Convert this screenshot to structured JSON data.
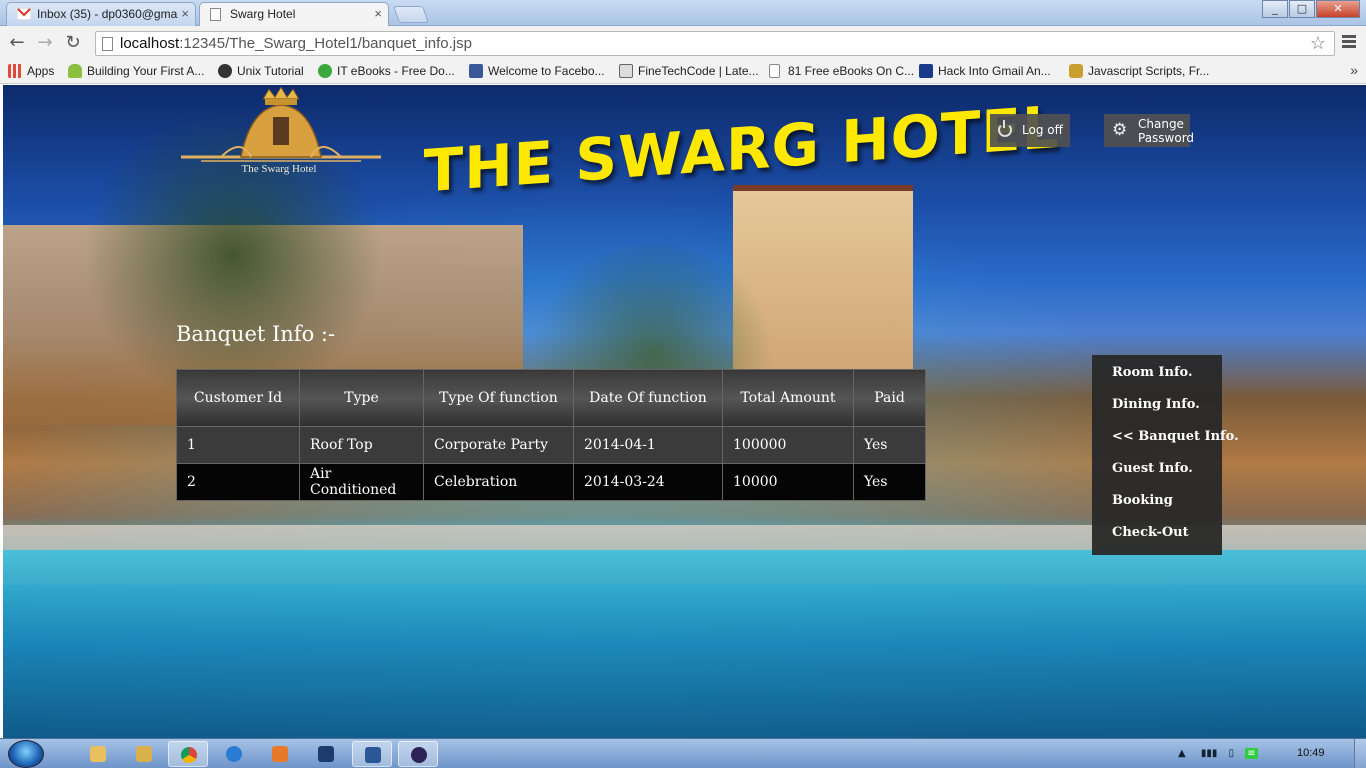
{
  "browser": {
    "tabs": [
      {
        "title": "Inbox (35) - dp0360@gma",
        "close": "×",
        "icon": "gmail-icon"
      },
      {
        "title": "Swarg Hotel",
        "close": "×",
        "icon": "page-icon"
      }
    ],
    "address": {
      "host": "localhost",
      "path": ":12345/The_Swarg_Hotel1/banquet_info.jsp"
    },
    "bookmarks": [
      {
        "label": "Apps",
        "icon": "apps-grid-icon",
        "color": "#e24a3b"
      },
      {
        "label": "Building Your First A...",
        "icon": "android-icon",
        "color": "#8cbf3f"
      },
      {
        "label": "Unix Tutorial",
        "icon": "unix-icon",
        "color": "#333333"
      },
      {
        "label": "IT eBooks - Free Do...",
        "icon": "green-dot-icon",
        "color": "#3aa83a"
      },
      {
        "label": "Welcome to Facebo...",
        "icon": "facebook-icon",
        "color": "#3b5998"
      },
      {
        "label": "FineTechCode | Late...",
        "icon": "ftc-icon",
        "color": "#666666"
      },
      {
        "label": "81 Free eBooks On C...",
        "icon": "page-icon",
        "color": "#ffffff"
      },
      {
        "label": "Hack Into Gmail An...",
        "icon": "efy-icon",
        "color": "#1a3b8a"
      },
      {
        "label": "Javascript Scripts, Fr...",
        "icon": "js-icon",
        "color": "#c9a030"
      }
    ],
    "bookmarks_more": "»"
  },
  "page": {
    "logo_text": "The Swarg Hotel",
    "site_title": "THE SWARG HOTEL",
    "logoff_label": "Log off",
    "change_password_line1": "Change",
    "change_password_line2": "Password",
    "section_title": "Banquet Info :-",
    "table": {
      "headers": [
        "Customer Id",
        "Type",
        "Type Of function",
        "Date Of function",
        "Total Amount",
        "Paid"
      ],
      "rows": [
        [
          "1",
          "Roof Top",
          "Corporate Party",
          "2014-04-1",
          "100000",
          "Yes"
        ],
        [
          "2",
          "Air Conditioned",
          "Celebration",
          "2014-03-24",
          "10000",
          "Yes"
        ]
      ]
    },
    "menu": [
      "Room Info.",
      "Dining Info.",
      "<< Banquet Info.",
      "Guest Info.",
      "Booking",
      "Check-Out"
    ]
  },
  "taskbar": {
    "clock": "10:49"
  }
}
